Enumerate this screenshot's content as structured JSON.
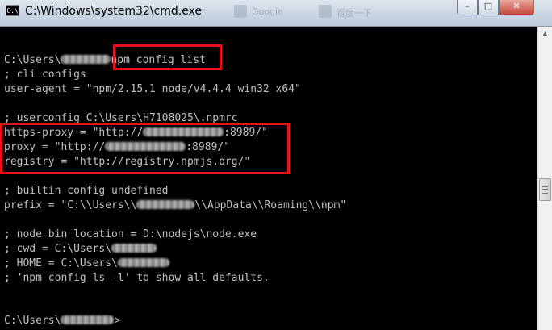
{
  "window": {
    "title": "C:\\Windows\\system32\\cmd.exe",
    "icon_label": "C:\\",
    "ghost_tab_1": "Google",
    "ghost_tab_2": "百度一下"
  },
  "controls": {
    "minimize_glyph": "–",
    "maximize_glyph": "□",
    "close_glyph": "✕"
  },
  "console": {
    "prompt_1_prefix": "C:\\Users\\",
    "prompt_1_command": "npm config list",
    "cli_configs": "; cli configs",
    "user_agent": "user-agent = \"npm/2.15.1 node/v4.4.4 win32 x64\"",
    "userconfig": "; userconfig C:\\Users\\H7108025\\.npmrc",
    "https_proxy_prefix": "https-proxy = \"http://",
    "https_proxy_suffix": ":8989/\"",
    "proxy_prefix": "proxy = \"http://",
    "proxy_suffix": ":8989/\"",
    "registry": "registry = \"http://registry.npmjs.org/\"",
    "builtin_config": "; builtin config undefined",
    "prefix_prefix": "prefix = \"C:\\\\Users\\\\",
    "prefix_suffix": "\\\\AppData\\\\Roaming\\\\npm\"",
    "node_bin_location": "; node bin location = D:\\nodejs\\node.exe",
    "cwd_prefix": "; cwd = C:\\Users\\",
    "home_prefix": "; HOME = C:\\Users\\",
    "show_all_defaults": "; 'npm config ls -l' to show all defaults.",
    "prompt_2_prefix": "C:\\Users\\",
    "prompt_2_suffix": ">"
  },
  "scrollbar": {
    "up_arrow_glyph": "▲"
  },
  "colors": {
    "console_text": "#c0c0c0",
    "console_background": "#000000",
    "highlight_border": "#e8121b"
  }
}
